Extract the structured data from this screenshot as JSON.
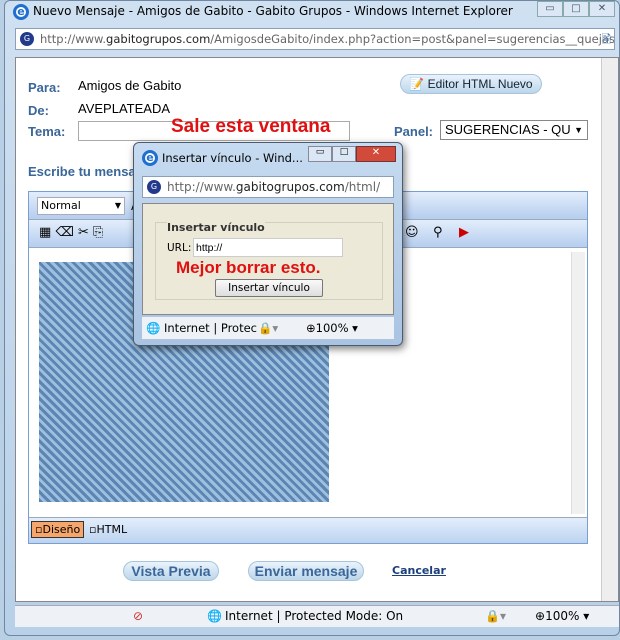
{
  "window": {
    "title": "Nuevo Mensaje - Amigos de Gabito - Gabito Grupos - Windows Internet Explorer",
    "url_prefix": "http://www.",
    "url_domain": "gabitogrupos.com",
    "url_rest": "/AmigosdeGabito/index.php?action=post&panel=sugerencias__quejas_"
  },
  "form": {
    "para_label": "Para:",
    "para_value": "Amigos de Gabito",
    "de_label": "De:",
    "de_value": "AVEPLATEADA",
    "tema_label": "Tema:",
    "tema_value": "",
    "panel_label": "Panel:",
    "panel_value": "SUGERENCIAS - QU",
    "editor_button": "Editor HTML Nuevo",
    "write_label": "Escribe tu mensaje"
  },
  "annotations": {
    "top": "Sale esta ventana",
    "popup": "Mejor borrar esto."
  },
  "editor": {
    "format": "Normal",
    "font_initial": "A",
    "tab_design": "Diseño",
    "tab_html": "HTML"
  },
  "actions": {
    "preview": "Vista Previa",
    "send": "Enviar mensaje",
    "cancel": "Cancelar"
  },
  "status": {
    "zone": "Internet | Protected Mode: On",
    "zoom": "100%"
  },
  "popup": {
    "title": "Insertar vínculo - Wind...",
    "url_prefix": "http://www.",
    "url_domain": "gabitogrupos.com",
    "url_rest": "/html/",
    "group": "Insertar vínculo",
    "url_label": "URL:",
    "url_value": "http://",
    "button": "Insertar vínculo",
    "zone": "Internet | Protec",
    "zoom": "100%"
  }
}
